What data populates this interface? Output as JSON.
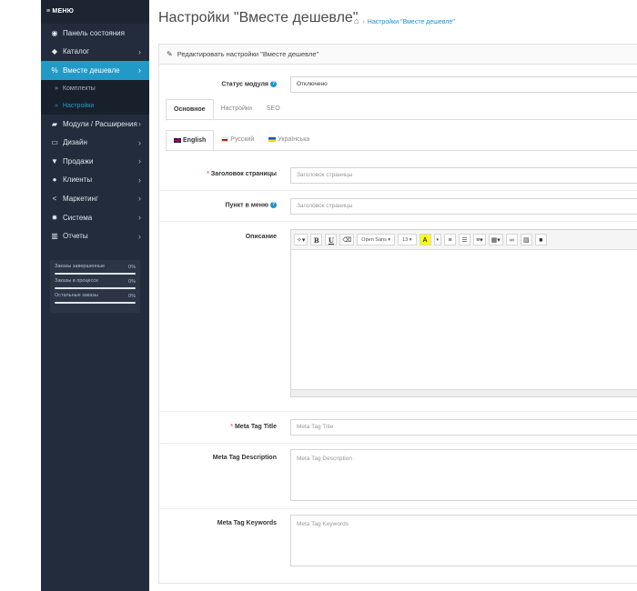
{
  "sidebar": {
    "menu_header": "≡ МЕНЮ",
    "items": [
      {
        "icon": "dashboard-icon",
        "glyph": "◉",
        "label": "Панель состояния"
      },
      {
        "icon": "tag-icon",
        "glyph": "◆",
        "label": "Каталог",
        "arrow": "›"
      },
      {
        "icon": "percent-icon",
        "glyph": "%",
        "label": "Вместе дешевле",
        "arrow": "›",
        "active": true
      },
      {
        "icon": "puzzle-icon",
        "glyph": "▰",
        "label": "Модули / Расширения",
        "arrow": "›"
      },
      {
        "icon": "desktop-icon",
        "glyph": "▭",
        "label": "Дизайн",
        "arrow": "›"
      },
      {
        "icon": "cart-icon",
        "glyph": "▼",
        "label": "Продажи",
        "arrow": "›"
      },
      {
        "icon": "user-icon",
        "glyph": "●",
        "label": "Клиенты",
        "arrow": "›"
      },
      {
        "icon": "share-icon",
        "glyph": "<",
        "label": "Маркетинг",
        "arrow": "›"
      },
      {
        "icon": "cog-icon",
        "glyph": "✹",
        "label": "Система",
        "arrow": "›"
      },
      {
        "icon": "bar-chart-icon",
        "glyph": "▥",
        "label": "Отчеты",
        "arrow": "›"
      }
    ],
    "subitems": [
      {
        "label": "Комплекты",
        "chev": "»"
      },
      {
        "label": "Настройки",
        "chev": "»",
        "current": true
      }
    ],
    "stats": [
      {
        "label": "Заказы завершенные",
        "value": "0%"
      },
      {
        "label": "Заказы в процессе",
        "value": "0%"
      },
      {
        "label": "Остальные заказы",
        "value": "0%"
      }
    ]
  },
  "header": {
    "title": "Настройки \"Вместе дешевле\"",
    "breadcrumb": "Настройки \"Вместе дешевле\""
  },
  "panel": {
    "heading": "Редактировать настройки \"Вместе дешевле\"",
    "status_label": "Статус модуля",
    "status_value": "Отключено",
    "tabs": [
      "Основное",
      "Настройки",
      "SEO"
    ],
    "languages": [
      "English",
      "Русский",
      "Українська"
    ],
    "fields": {
      "page_title_label": "Заголовок страницы",
      "page_title_placeholder": "Заголовок страницы",
      "menu_item_label": "Пункт в меню",
      "menu_item_placeholder": "Заголовок страницы",
      "description_label": "Описание",
      "meta_title_label": "Meta Tag Title",
      "meta_title_placeholder": "Meta Tag Title",
      "meta_desc_label": "Meta Tag Description",
      "meta_desc_placeholder": "Meta Tag Description",
      "meta_keywords_label": "Meta Tag Keywords",
      "meta_keywords_placeholder": "Meta Tag Keywords"
    },
    "editor": {
      "font_name": "Open Sans",
      "font_size": "13",
      "highlight_letter": "A"
    }
  }
}
